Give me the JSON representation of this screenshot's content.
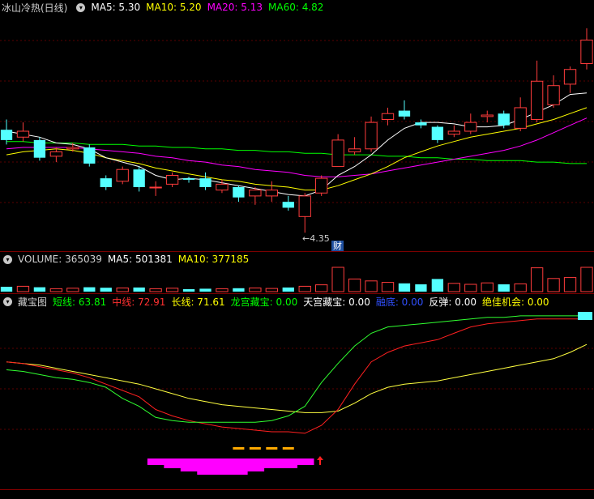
{
  "main_header": {
    "title": "冰山冷热(日线)",
    "ma5": "MA5: 5.30",
    "ma10": "MA10: 5.20",
    "ma20": "MA20: 5.13",
    "ma60": "MA60: 4.82"
  },
  "volume_header": {
    "volume": "VOLUME: 365039",
    "ma5": "MA5: 501381",
    "ma10": "MA10: 377185"
  },
  "indicator_header": {
    "name": "藏宝图",
    "short": "短线: 63.81",
    "mid": "中线: 72.91",
    "long": "长线: 71.61",
    "longgong": "龙宫藏宝: 0.00",
    "tiangong": "天宫藏宝: 0.00",
    "rongdi": "融底: 0.00",
    "fantan": "反弹: 0.00",
    "best": "绝佳机会: 0.00"
  },
  "annotations": {
    "low_price": "←4.35",
    "finance_badge": "财"
  },
  "colors": {
    "up": "#ff3c3c",
    "down": "#54ffff",
    "ma5": "#ffffff",
    "ma10": "#ffff00",
    "ma20": "#ff00ff",
    "ma60": "#00ff00",
    "magenta_fill": "#ff00ff",
    "orange_bar": "#ffaa00"
  },
  "chart_data": {
    "type": "candlestick",
    "candles": [
      {
        "o": 5.05,
        "c": 4.98,
        "h": 5.12,
        "l": 4.95
      },
      {
        "o": 5.0,
        "c": 5.04,
        "h": 5.1,
        "l": 4.97
      },
      {
        "o": 4.98,
        "c": 4.86,
        "h": 5.0,
        "l": 4.84
      },
      {
        "o": 4.87,
        "c": 4.9,
        "h": 4.93,
        "l": 4.83
      },
      {
        "o": 4.92,
        "c": 4.93,
        "h": 4.96,
        "l": 4.9
      },
      {
        "o": 4.93,
        "c": 4.82,
        "h": 4.95,
        "l": 4.8
      },
      {
        "o": 4.72,
        "c": 4.66,
        "h": 4.74,
        "l": 4.64
      },
      {
        "o": 4.7,
        "c": 4.78,
        "h": 4.8,
        "l": 4.68
      },
      {
        "o": 4.78,
        "c": 4.66,
        "h": 4.8,
        "l": 4.63
      },
      {
        "o": 4.66,
        "c": 4.66,
        "h": 4.7,
        "l": 4.6
      },
      {
        "o": 4.68,
        "c": 4.74,
        "h": 4.76,
        "l": 4.66
      },
      {
        "o": 4.72,
        "c": 4.71,
        "h": 4.73,
        "l": 4.69
      },
      {
        "o": 4.72,
        "c": 4.66,
        "h": 4.76,
        "l": 4.64
      },
      {
        "o": 4.64,
        "c": 4.68,
        "h": 4.71,
        "l": 4.62
      },
      {
        "o": 4.66,
        "c": 4.59,
        "h": 4.67,
        "l": 4.56
      },
      {
        "o": 4.6,
        "c": 4.64,
        "h": 4.66,
        "l": 4.54
      },
      {
        "o": 4.6,
        "c": 4.64,
        "h": 4.7,
        "l": 4.56
      },
      {
        "o": 4.56,
        "c": 4.52,
        "h": 4.6,
        "l": 4.5
      },
      {
        "o": 4.46,
        "c": 4.6,
        "h": 4.62,
        "l": 4.35
      },
      {
        "o": 4.62,
        "c": 4.72,
        "h": 4.74,
        "l": 4.6
      },
      {
        "o": 4.8,
        "c": 4.98,
        "h": 5.02,
        "l": 4.84
      },
      {
        "o": 4.9,
        "c": 4.92,
        "h": 5.0,
        "l": 4.88
      },
      {
        "o": 4.92,
        "c": 5.1,
        "h": 5.14,
        "l": 4.9
      },
      {
        "o": 5.12,
        "c": 5.16,
        "h": 5.2,
        "l": 5.08
      },
      {
        "o": 5.18,
        "c": 5.14,
        "h": 5.25,
        "l": 5.12
      },
      {
        "o": 5.1,
        "c": 5.08,
        "h": 5.12,
        "l": 5.06
      },
      {
        "o": 5.07,
        "c": 4.98,
        "h": 5.08,
        "l": 4.96
      },
      {
        "o": 5.02,
        "c": 5.04,
        "h": 5.08,
        "l": 5.0
      },
      {
        "o": 5.04,
        "c": 5.1,
        "h": 5.16,
        "l": 5.02
      },
      {
        "o": 5.14,
        "c": 5.15,
        "h": 5.18,
        "l": 5.1
      },
      {
        "o": 5.16,
        "c": 5.08,
        "h": 5.18,
        "l": 5.06
      },
      {
        "o": 5.06,
        "c": 5.2,
        "h": 5.27,
        "l": 5.04
      },
      {
        "o": 5.12,
        "c": 5.38,
        "h": 5.52,
        "l": 5.1
      },
      {
        "o": 5.22,
        "c": 5.35,
        "h": 5.42,
        "l": 5.2
      },
      {
        "o": 5.36,
        "c": 5.46,
        "h": 5.48,
        "l": 5.3
      },
      {
        "o": 5.5,
        "c": 5.66,
        "h": 5.74,
        "l": 5.46
      }
    ],
    "ma": {
      "ma5": [
        5.04,
        5.02,
        5.0,
        4.96,
        4.95,
        4.92,
        4.86,
        4.83,
        4.8,
        4.74,
        4.71,
        4.72,
        4.71,
        4.69,
        4.67,
        4.65,
        4.63,
        4.61,
        4.6,
        4.64,
        4.74,
        4.8,
        4.88,
        4.98,
        5.06,
        5.1,
        5.1,
        5.09,
        5.07,
        5.07,
        5.08,
        5.12,
        5.17,
        5.22,
        5.29,
        5.3
      ],
      "ma10": [
        4.88,
        4.9,
        4.91,
        4.92,
        4.91,
        4.89,
        4.86,
        4.84,
        4.82,
        4.79,
        4.77,
        4.75,
        4.73,
        4.71,
        4.7,
        4.68,
        4.67,
        4.66,
        4.64,
        4.64,
        4.67,
        4.71,
        4.75,
        4.8,
        4.86,
        4.9,
        4.94,
        4.97,
        5.0,
        5.02,
        5.04,
        5.06,
        5.09,
        5.12,
        5.16,
        5.2
      ],
      "ma20": [
        4.92,
        4.93,
        4.93,
        4.93,
        4.93,
        4.92,
        4.91,
        4.9,
        4.89,
        4.87,
        4.86,
        4.84,
        4.83,
        4.81,
        4.8,
        4.78,
        4.77,
        4.76,
        4.74,
        4.73,
        4.73,
        4.74,
        4.75,
        4.77,
        4.79,
        4.81,
        4.83,
        4.85,
        4.87,
        4.89,
        4.91,
        4.94,
        4.98,
        5.03,
        5.08,
        5.13
      ],
      "ma60": [
        4.97,
        4.97,
        4.96,
        4.96,
        4.96,
        4.95,
        4.95,
        4.95,
        4.94,
        4.94,
        4.93,
        4.93,
        4.92,
        4.92,
        4.91,
        4.91,
        4.9,
        4.9,
        4.89,
        4.89,
        4.88,
        4.88,
        4.88,
        4.87,
        4.87,
        4.86,
        4.86,
        4.85,
        4.85,
        4.84,
        4.84,
        4.84,
        4.83,
        4.83,
        4.82,
        4.82
      ]
    },
    "price_range": [
      4.28,
      5.8
    ],
    "volume": [
      20,
      22,
      18,
      12,
      14,
      18,
      16,
      15,
      17,
      12,
      14,
      10,
      12,
      12,
      14,
      15,
      13,
      17,
      22,
      28,
      100,
      52,
      44,
      38,
      34,
      30,
      52,
      34,
      30,
      36,
      30,
      32,
      98,
      54,
      58,
      100
    ],
    "volume_max": 100,
    "indicator": {
      "short": [
        63,
        62,
        60,
        58,
        57,
        55,
        52,
        45,
        40,
        33,
        31,
        30,
        30,
        30,
        30,
        30,
        31,
        34,
        40,
        55,
        67,
        78,
        86,
        90,
        91,
        92,
        93,
        94,
        95,
        96,
        96,
        97,
        97,
        97,
        97,
        97
      ],
      "mid": [
        68,
        67,
        65,
        63,
        61,
        58,
        54,
        50,
        46,
        38,
        34,
        31,
        29,
        27,
        26,
        25,
        24,
        24,
        23,
        28,
        38,
        54,
        68,
        74,
        78,
        80,
        82,
        86,
        90,
        92,
        93,
        94,
        95,
        95,
        95,
        95
      ],
      "long": [
        68,
        67,
        66,
        64,
        62,
        60,
        58,
        56,
        54,
        51,
        48,
        45,
        43,
        41,
        40,
        39,
        38,
        37,
        36,
        36,
        37,
        42,
        48,
        52,
        54,
        55,
        56,
        58,
        60,
        62,
        64,
        66,
        68,
        70,
        74,
        79
      ],
      "range": [
        0,
        100
      ],
      "magenta_fill": [
        0,
        0,
        0,
        0,
        0,
        0,
        0,
        0,
        0,
        2,
        3,
        4,
        5,
        5,
        5,
        4,
        3,
        3,
        2,
        0,
        0,
        0,
        0,
        0,
        0,
        0,
        0,
        0,
        0,
        0,
        0,
        0,
        0,
        0,
        0,
        0
      ]
    }
  }
}
